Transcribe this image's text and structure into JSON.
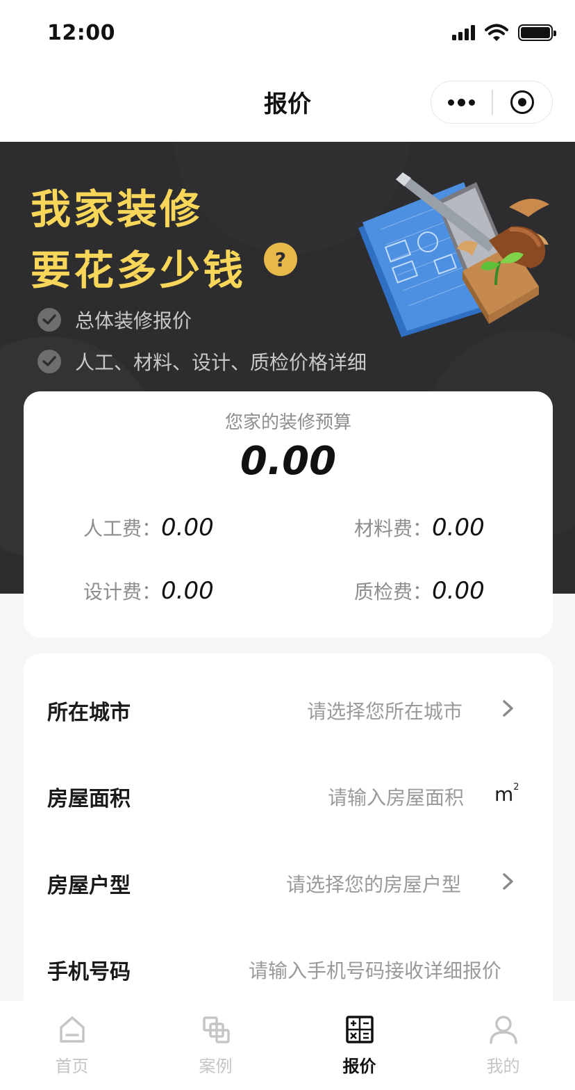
{
  "status_bar": {
    "time": "12:00",
    "icons": [
      "signal-icon",
      "wifi-icon",
      "battery-icon"
    ]
  },
  "nav": {
    "title": "报价",
    "more_icon": "more-dots-icon",
    "close_icon": "target-close-icon"
  },
  "hero": {
    "headline_line1": "我家装修",
    "headline_line2": "要花多少钱",
    "question_mark": "?",
    "features": [
      "总体装修报价",
      "人工、材料、设计、质检价格详细"
    ],
    "accent_color": "#f7d65a",
    "background_color": "#2d2d2f"
  },
  "budget": {
    "label": "您家的装修预算",
    "total": "0.00",
    "fees": {
      "labor": {
        "label": "人工费：",
        "value": "0.00"
      },
      "material": {
        "label": "材料费：",
        "value": "0.00"
      },
      "design": {
        "label": "设计费：",
        "value": "0.00"
      },
      "inspection": {
        "label": "质检费：",
        "value": "0.00"
      }
    }
  },
  "form": {
    "city": {
      "label": "所在城市",
      "placeholder": "请选择您所在城市"
    },
    "area": {
      "label": "房屋面积",
      "placeholder": "请输入房屋面积",
      "unit": "m",
      "unit_sup": "2"
    },
    "layout": {
      "label": "房屋户型",
      "placeholder": "请选择您的房屋户型"
    },
    "phone": {
      "label": "手机号码",
      "placeholder": "请输入手机号码接收详细报价"
    }
  },
  "tabs": [
    {
      "label": "首页",
      "icon": "home-icon",
      "active": false
    },
    {
      "label": "案例",
      "icon": "cases-icon",
      "active": false
    },
    {
      "label": "报价",
      "icon": "calculator-icon",
      "active": true
    },
    {
      "label": "我的",
      "icon": "profile-icon",
      "active": false
    }
  ]
}
